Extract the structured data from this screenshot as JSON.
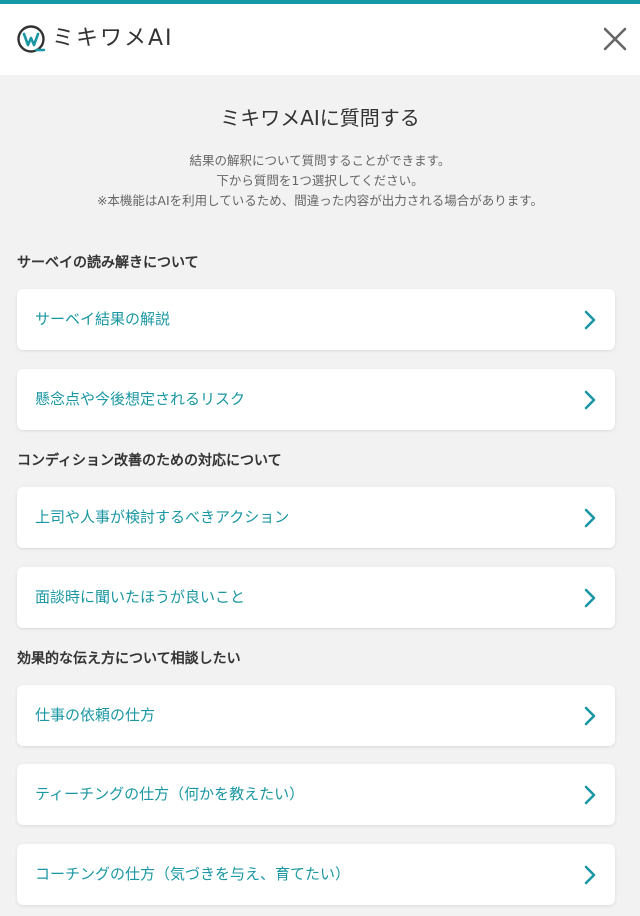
{
  "app": {
    "logo_text": "ミキワメAI",
    "accent_color": "#139aa6",
    "close_icon": "close-icon"
  },
  "intro": {
    "title": "ミキワメAIに質問する",
    "description_lines": [
      "結果の解釈について質問することができます。",
      "下から質問を1つ選択してください。",
      "※本機能はAIを利用しているため、間違った内容が出力される場合があります。"
    ]
  },
  "sections": [
    {
      "heading": "サーベイの読み解きについて",
      "options": [
        "サーベイ結果の解説",
        "懸念点や今後想定されるリスク"
      ]
    },
    {
      "heading": "コンディション改善のための対応について",
      "options": [
        "上司や人事が検討するべきアクション",
        "面談時に聞いたほうが良いこと"
      ]
    },
    {
      "heading": "効果的な伝え方について相談したい",
      "options": [
        "仕事の依頼の仕方",
        "ティーチングの仕方（何かを教えたい）",
        "コーチングの仕方（気づきを与え、育てたい）"
      ]
    }
  ],
  "colors": {
    "option_text": "#1a97a3",
    "background": "#f2f2f2",
    "card": "#ffffff"
  }
}
